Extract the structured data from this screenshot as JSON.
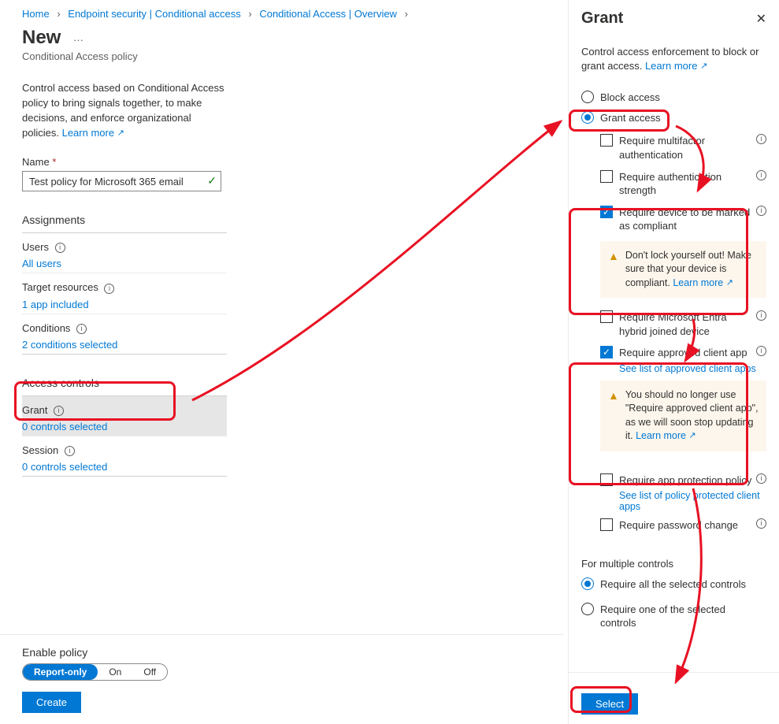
{
  "breadcrumbs": {
    "home": "Home",
    "b1": "Endpoint security | Conditional access",
    "b2": "Conditional Access | Overview"
  },
  "page": {
    "title": "New",
    "subtitle": "Conditional Access policy",
    "intro": "Control access based on Conditional Access policy to bring signals together, to make decisions, and enforce organizational policies.",
    "learn_more": "Learn more"
  },
  "name_field": {
    "label": "Name",
    "value": "Test policy for Microsoft 365 email"
  },
  "assignments": {
    "header": "Assignments",
    "users_label": "Users",
    "users_value": "All users",
    "target_label": "Target resources",
    "target_value": "1 app included",
    "conditions_label": "Conditions",
    "conditions_value": "2 conditions selected"
  },
  "access_controls": {
    "header": "Access controls",
    "grant_label": "Grant",
    "grant_value": "0 controls selected",
    "session_label": "Session",
    "session_value": "0 controls selected"
  },
  "bottom": {
    "enable_label": "Enable policy",
    "report_only": "Report-only",
    "on": "On",
    "off": "Off",
    "create": "Create"
  },
  "flyout": {
    "title": "Grant",
    "desc": "Control access enforcement to block or grant access.",
    "learn_more": "Learn more",
    "block": "Block access",
    "grant": "Grant access",
    "mfa": "Require multifactor authentication",
    "strength": "Require authentication strength",
    "compliant": "Require device to be marked as compliant",
    "compliant_warn": "Don't lock yourself out! Make sure that your device is compliant.",
    "hybrid": "Require Microsoft Entra hybrid joined device",
    "approved": "Require approved client app",
    "approved_link": "See list of approved client apps",
    "approved_warn": "You should no longer use \"Require approved client app\", as we will soon stop updating it.",
    "app_protect": "Require app protection policy",
    "app_protect_link": "See list of policy protected client apps",
    "pwd_change": "Require password change",
    "multi_hdr": "For multiple controls",
    "multi_all": "Require all the selected controls",
    "multi_one": "Require one of the selected controls",
    "select": "Select"
  }
}
